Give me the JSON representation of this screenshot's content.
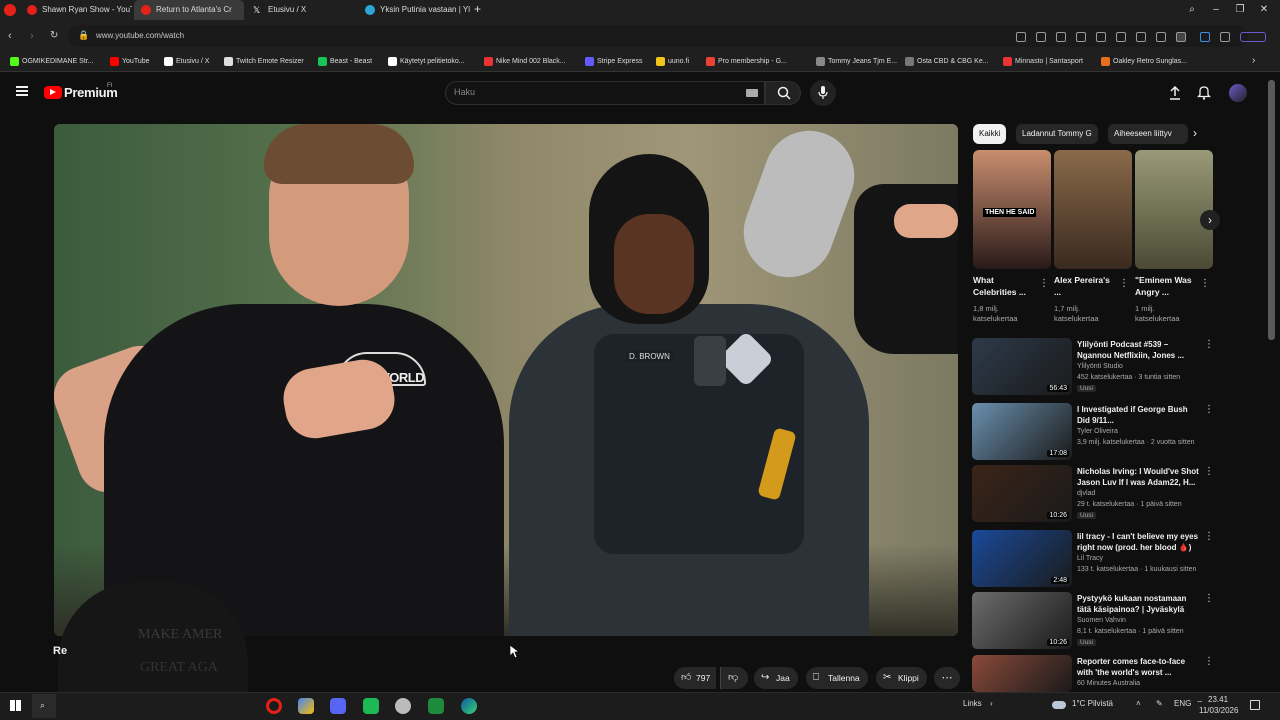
{
  "browser": {
    "tabs": [
      {
        "label": "Shawn Ryan Show - YouTu",
        "active": false,
        "icon_color": "#e62117"
      },
      {
        "label": "Return to Atlanta's Cr",
        "active": true,
        "icon_color": "#e62117"
      },
      {
        "label": "Etusivu / X",
        "active": false,
        "icon_color": "#ffffff"
      },
      {
        "label": "Yksin Putinia vastaan | Yle",
        "active": false,
        "icon_color": "#2aa6d8"
      }
    ],
    "url": "www.youtube.com/watch",
    "bookmarks": [
      {
        "label": "OGMIKEDIMANE Str...",
        "color": "#53fc18"
      },
      {
        "label": "YouTube",
        "color": "#ff0000"
      },
      {
        "label": "Etusivu / X",
        "color": "#ffffff"
      },
      {
        "label": "Twitch Emote Resizer",
        "color": "#dddddd"
      },
      {
        "label": "Beast - Beast",
        "color": "#18c45a"
      },
      {
        "label": "Käytetyt pelitietoko...",
        "color": "#ffffff"
      },
      {
        "label": "Nike Mind 002 Black...",
        "color": "#e33"
      },
      {
        "label": "Stripe Express",
        "color": "#635bff"
      },
      {
        "label": "uuno.fi",
        "color": "#f0c419"
      },
      {
        "label": "Pro membership - G...",
        "color": "#ea4335"
      },
      {
        "label": "Tommy Jeans Tjm E...",
        "color": "#888888"
      },
      {
        "label": "Osta CBD & CBG Ke...",
        "color": "#777777"
      },
      {
        "label": "Minnasto | Santasport",
        "color": "#e33"
      },
      {
        "label": "Oakley Retro Sunglas...",
        "color": "#e76f1e"
      }
    ]
  },
  "youtube": {
    "logo": "Premium",
    "logo_sup": "FI",
    "search_placeholder": "Haku",
    "chips": [
      "Kaikki",
      "Ladannut Tommy G",
      "Aiheeseen liittyv"
    ],
    "video_shirt_text": "UNDERWORLD",
    "badge_name": "D. BROWN",
    "title_partial": "Re",
    "webcam_text": [
      "MAKE AMER",
      "GREAT AGA"
    ],
    "actions": {
      "likes": "797",
      "share": "Jaa",
      "save": "Tallenna",
      "clip": "Klippi"
    },
    "shorts": [
      {
        "title": "What Celebrities ...",
        "views": "1,8 milj. katselukertaa",
        "overlay": "THEN HE SAID"
      },
      {
        "title": "Alex Pereira's ...",
        "views": "1,7 milj. katselukertaa",
        "overlay": ""
      },
      {
        "title": "\"Eminem Was Angry ...",
        "views": "1 milj. katselukertaa",
        "overlay": ""
      }
    ],
    "related": [
      {
        "title": "Ylilyönti Podcast #539 – Ngannou Netflixiin, Jones ...",
        "channel": "Ylilyönti Studio",
        "meta": "452 katselukertaa · 3 tuntia sitten",
        "duration": "56:43",
        "badge": "Uusi",
        "color": "#2d3a4a"
      },
      {
        "title": "I Investigated if George Bush Did 9/11...",
        "channel": "Tyler Oliveira",
        "meta": "3,9 milj. katselukertaa · 2 vuotta sitten",
        "duration": "17:08",
        "badge": "",
        "color": "#6a8fae"
      },
      {
        "title": "Nicholas Irving: I Would've Shot Jason Luv If I was Adam22, H...",
        "channel": "djvlad",
        "meta": "29 t. katselukertaa · 1 päivä sitten",
        "duration": "10:26",
        "badge": "Uusi",
        "color": "#3b2418"
      },
      {
        "title": "lil tracy - I can't believe my eyes right now (prod. her blood 🩸)",
        "channel": "Lil Tracy",
        "meta": "133 t. katselukertaa · 1 kuukausi sitten",
        "duration": "2:48",
        "badge": "",
        "color": "#1a4a9a"
      },
      {
        "title": "Pystyykö kukaan nostamaan tätä käsipainoa? | Jyväskylä",
        "channel": "Suomen Vahvin",
        "meta": "8,1 t. katselukertaa · 1 päivä sitten",
        "duration": "10:26",
        "badge": "Uusi",
        "color": "#6c6c6c"
      },
      {
        "title": "Reporter comes face-to-face with 'the world's worst ...",
        "channel": "60 Minutes Australia",
        "meta": "",
        "duration": "",
        "badge": "",
        "color": "#8a4a3a"
      }
    ]
  },
  "taskbar": {
    "tray_label": "Links",
    "weather": "1°C Pilvistä",
    "lang": "ENG",
    "time": "23.41",
    "date": "11/03/2026"
  }
}
